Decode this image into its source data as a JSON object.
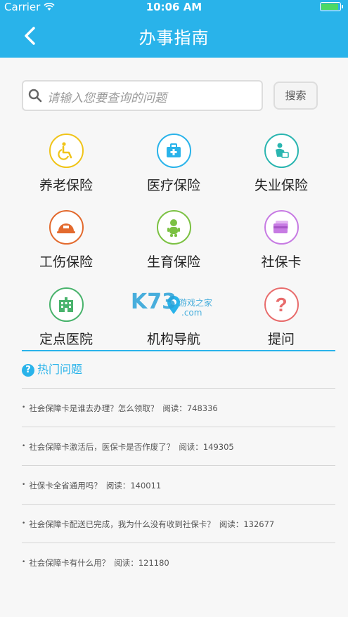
{
  "status_bar": {
    "carrier": "Carrier",
    "time": "10:06 AM",
    "battery_level": 0.95
  },
  "nav": {
    "title": "办事指南",
    "back_icon": "chevron-left-icon"
  },
  "search": {
    "placeholder": "请输入您要查询的问题",
    "button": "搜索"
  },
  "services": [
    {
      "label": "养老保险",
      "icon": "wheelchair-icon",
      "color": "#f0c419"
    },
    {
      "label": "医疗保险",
      "icon": "medical-kit-icon",
      "color": "#29b3ea"
    },
    {
      "label": "失业保险",
      "icon": "unemployed-person-icon",
      "color": "#2ab5b0"
    },
    {
      "label": "工伤保险",
      "icon": "safety-helmet-icon",
      "color": "#e36a2e"
    },
    {
      "label": "生育保险",
      "icon": "baby-icon",
      "color": "#7bc142"
    },
    {
      "label": "社保卡",
      "icon": "card-icon",
      "color": "#c77be3"
    },
    {
      "label": "定点医院",
      "icon": "hospital-building-icon",
      "color": "#49b36c"
    },
    {
      "label": "机构导航",
      "icon": "map-pin-icon",
      "color": "#29b3ea"
    },
    {
      "label": "提问",
      "icon": "question-icon",
      "color": "#e86c6c"
    }
  ],
  "watermark": {
    "main": "K73",
    "sub": "游戏之家",
    "domain": ".com"
  },
  "hot": {
    "title": "热门问题",
    "reads_label": "阅读：",
    "questions": [
      {
        "text": "社会保障卡是谁去办理？怎么领取？",
        "reads": "748336"
      },
      {
        "text": "社会保障卡激活后，医保卡是否作废了？",
        "reads": "149305"
      },
      {
        "text": "社保卡全省通用吗？",
        "reads": "140011"
      },
      {
        "text": "社会保障卡配送已完成，我为什么没有收到社保卡？",
        "reads": "132677"
      },
      {
        "text": "社会保障卡有什么用？",
        "reads": "121180"
      }
    ]
  }
}
